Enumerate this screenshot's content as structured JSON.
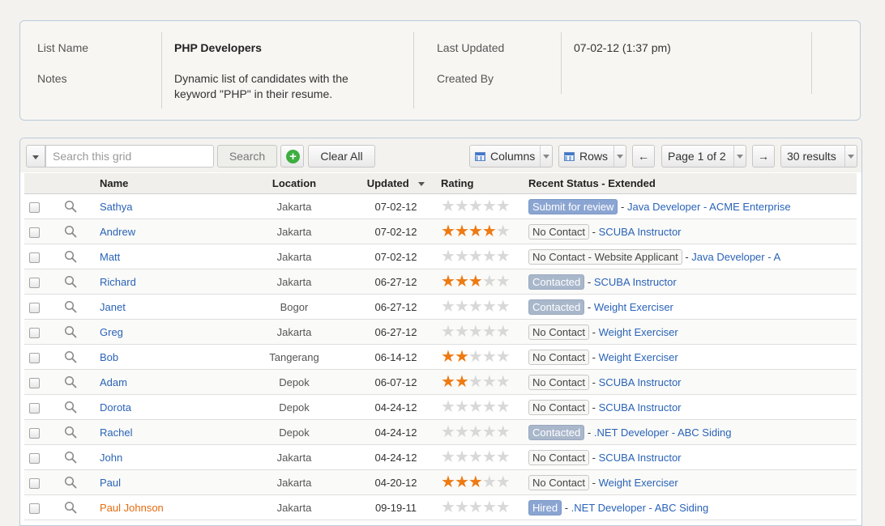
{
  "info": {
    "list_name_label": "List Name",
    "list_name_value": "PHP Developers",
    "notes_label": "Notes",
    "notes_value_line1": "Dynamic list of candidates with the",
    "notes_value_line2": "keyword \"PHP\" in their resume.",
    "last_updated_label": "Last Updated",
    "last_updated_value": "07-02-12 (1:37 pm)",
    "created_by_label": "Created By",
    "created_by_value": ""
  },
  "toolbar": {
    "search_placeholder": "Search this grid",
    "search_button": "Search",
    "add_icon": "plus-circle-icon",
    "clear_all_button": "Clear All",
    "columns_button": "Columns",
    "rows_button": "Rows",
    "prev_icon": "←",
    "page_label": "Page 1 of 2",
    "next_icon": "→",
    "results_label": "30 results"
  },
  "columns": {
    "name": "Name",
    "location": "Location",
    "updated": "Updated",
    "rating": "Rating",
    "status": "Recent Status - Extended"
  },
  "rows": [
    {
      "name": "Sathya",
      "location": "Jakarta",
      "updated": "07-02-12",
      "rating": 0,
      "status_badge": "Submit for review",
      "badge_style": "blue",
      "status_rest": "Java Developer - ACME Enterprise"
    },
    {
      "name": "Andrew",
      "location": "Jakarta",
      "updated": "07-02-12",
      "rating": 4,
      "status_badge": "No Contact",
      "badge_style": "plain",
      "status_rest": "SCUBA Instructor"
    },
    {
      "name": "Matt",
      "location": "Jakarta",
      "updated": "07-02-12",
      "rating": 0,
      "status_badge": "No Contact - Website Applicant",
      "badge_style": "plain",
      "status_rest": "Java Developer - A"
    },
    {
      "name": "Richard",
      "location": "Jakarta",
      "updated": "06-27-12",
      "rating": 3,
      "status_badge": "Contacted",
      "badge_style": "grey",
      "status_rest": "SCUBA Instructor"
    },
    {
      "name": "Janet",
      "location": "Bogor",
      "updated": "06-27-12",
      "rating": 0,
      "status_badge": "Contacted",
      "badge_style": "grey",
      "status_rest": "Weight Exerciser"
    },
    {
      "name": "Greg",
      "location": "Jakarta",
      "updated": "06-27-12",
      "rating": 0,
      "status_badge": "No Contact",
      "badge_style": "plain",
      "status_rest": "Weight Exerciser"
    },
    {
      "name": "Bob",
      "location": "Tangerang",
      "updated": "06-14-12",
      "rating": 2,
      "status_badge": "No Contact",
      "badge_style": "plain",
      "status_rest": "Weight Exerciser"
    },
    {
      "name": "Adam",
      "location": "Depok",
      "updated": "06-07-12",
      "rating": 2,
      "status_badge": "No Contact",
      "badge_style": "plain",
      "status_rest": "SCUBA Instructor"
    },
    {
      "name": "Dorota",
      "location": "Depok",
      "updated": "04-24-12",
      "rating": 0,
      "status_badge": "No Contact",
      "badge_style": "plain",
      "status_rest": "SCUBA Instructor"
    },
    {
      "name": "Rachel",
      "location": "Depok",
      "updated": "04-24-12",
      "rating": 0,
      "status_badge": "Contacted",
      "badge_style": "grey",
      "status_rest": ".NET Developer - ABC Siding"
    },
    {
      "name": "John",
      "location": "Jakarta",
      "updated": "04-24-12",
      "rating": 0,
      "status_badge": "No Contact",
      "badge_style": "plain",
      "status_rest": "SCUBA Instructor"
    },
    {
      "name": "Paul",
      "location": "Jakarta",
      "updated": "04-20-12",
      "rating": 3,
      "status_badge": "No Contact",
      "badge_style": "plain",
      "status_rest": "Weight Exerciser"
    },
    {
      "name": "Paul Johnson",
      "name_color": "#e46b0e",
      "location": "Jakarta",
      "updated": "09-19-11",
      "rating": 0,
      "status_badge": "Hired",
      "badge_style": "blue",
      "status_rest": ".NET Developer - ABC Siding"
    }
  ],
  "colors": {
    "link": "#2a63b8",
    "star_on": "#ee7a12",
    "star_off": "#d8d8d8",
    "highlight_name": "#e46b0e"
  }
}
